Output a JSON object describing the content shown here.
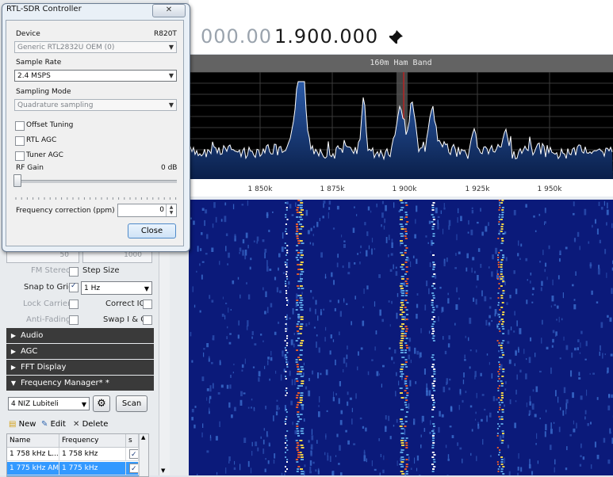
{
  "main": {
    "freq_dim": "000.00",
    "freq_main": "1.900.000",
    "band_name": "160m Ham Band",
    "tick_labels": [
      "1 850k",
      "1 875k",
      "1 900k",
      "1 925k",
      "1 950k"
    ]
  },
  "dialog": {
    "title": "RTL-SDR Controller",
    "close_x": "✕",
    "device_label": "Device",
    "device_tuner": "R820T",
    "device_value": "Generic RTL2832U OEM (0)",
    "sample_rate_label": "Sample Rate",
    "sample_rate_value": "2.4 MSPS",
    "sampling_mode_label": "Sampling Mode",
    "sampling_mode_value": "Quadrature sampling",
    "offset_tuning": "Offset Tuning",
    "rtl_agc": "RTL AGC",
    "tuner_agc": "Tuner AGC",
    "rf_gain_label": "RF Gain",
    "rf_gain_value": "0 dB",
    "freq_corr_label": "Frequency correction (ppm)",
    "freq_corr_value": "0",
    "close_button": "Close"
  },
  "left": {
    "hidden_value_1": "50",
    "hidden_value_2": "1000",
    "fm_stereo": "FM Stereo",
    "step_size": "Step Size",
    "snap_to_grid": "Snap to Grid",
    "snap_value": "1 Hz",
    "lock_carrier": "Lock Carrier",
    "correct_iq": "Correct IQ",
    "anti_fading": "Anti-Fading",
    "swap_iq": "Swap I & Q",
    "sections": [
      "Audio",
      "AGC",
      "FFT Display",
      "Frequency Manager* *"
    ],
    "group_value": "4 NIZ Lubiteli",
    "scan_button": "Scan",
    "new_button": "New",
    "edit_button": "Edit",
    "delete_button": "Delete",
    "table_headers": [
      "Name",
      "Frequency",
      "s"
    ],
    "table_rows": [
      {
        "name": "1 758 kHz L...",
        "freq": "1 758 kHz"
      },
      {
        "name": "1 775 kHz AM",
        "freq": "1 775 kHz"
      }
    ]
  },
  "colors": {
    "spectrum_fill": "#1f4a8a",
    "waterfall_bg": "#0b1a7a",
    "section_bar": "#3a3a3a",
    "center_marker": "#8a1f1f"
  }
}
